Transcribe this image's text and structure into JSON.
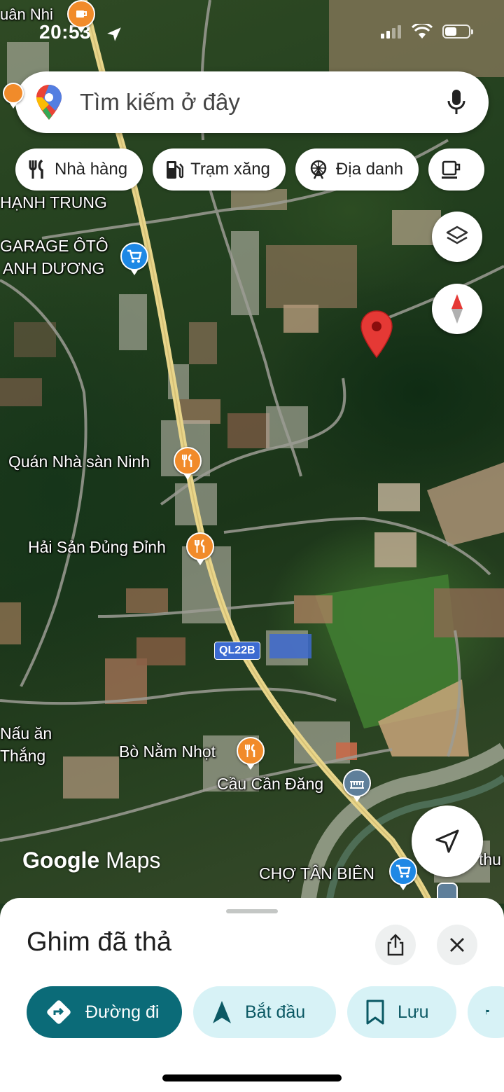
{
  "status_bar": {
    "time": "20:53",
    "battery_level": 0.45
  },
  "search": {
    "placeholder": "Tìm kiếm ở đây",
    "icons": [
      "google-maps-pin-icon",
      "microphone-icon"
    ]
  },
  "chips": [
    {
      "label": "Nhà hàng",
      "icon": "fork-knife-icon"
    },
    {
      "label": "Trạm xăng",
      "icon": "gas-pump-icon"
    },
    {
      "label": "Địa danh",
      "icon": "ferris-wheel-icon"
    },
    {
      "label": "",
      "icon": "coffee-cup-icon"
    }
  ],
  "map": {
    "labels": {
      "top_left": "uân Nhi",
      "area": "HẠNH TRUNG",
      "garage_1": "GARAGE ÔTÔ",
      "garage_2": "ANH DƯƠNG",
      "poi_1": "Quán Nhà sàn Ninh",
      "poi_2": "Hải Sản Đủng Đỉnh",
      "road": "QL22B",
      "left_1": "Nấu ăn",
      "left_2": "Thắng",
      "poi_3": "Bò Nằm Nhọt",
      "poi_4": "Cầu Cần Đăng",
      "market": "CHỢ TÂN BIÊN",
      "right_edge": "thu"
    },
    "attribution": {
      "google": "Google",
      "maps": "Maps"
    },
    "pin_color": "#e53935",
    "controls": [
      "layers-icon",
      "compass-icon",
      "my-location-icon"
    ]
  },
  "sheet": {
    "title": "Ghim đã thả",
    "actions": [
      {
        "label": "Đường đi",
        "icon": "directions-icon",
        "style": "primary"
      },
      {
        "label": "Bắt đầu",
        "icon": "navigation-arrow-icon",
        "style": "secondary"
      },
      {
        "label": "Lưu",
        "icon": "bookmark-icon",
        "style": "secondary"
      },
      {
        "label": "",
        "icon": "flag-icon",
        "style": "secondary"
      }
    ],
    "buttons": [
      "share-icon",
      "close-icon"
    ]
  },
  "colors": {
    "primary_action": "#0b6b78",
    "secondary_action": "#d7f2f6",
    "food_poi": "#f18b2a",
    "shop_poi": "#1e88e5"
  }
}
